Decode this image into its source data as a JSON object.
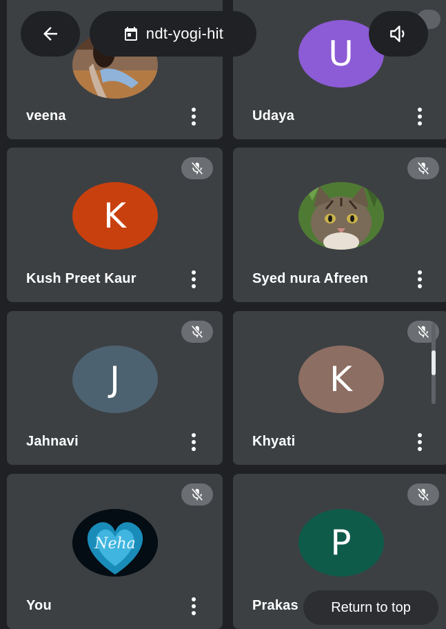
{
  "header": {
    "meeting_code": "ndt-yogi-hit",
    "back_icon": "arrow-left-icon",
    "calendar_icon": "calendar-icon",
    "speaker_icon": "speaker-icon"
  },
  "participants": [
    {
      "name": "veena",
      "avatar": "photo"
    },
    {
      "name": "Udaya",
      "initial": "U",
      "color": "#8c5bd6"
    },
    {
      "name": "Kush Preet Kaur",
      "initial": "K",
      "color": "#c9400f"
    },
    {
      "name": "Syed nura Afreen",
      "avatar": "photo"
    },
    {
      "name": "Jahnavi",
      "initial": "J",
      "color": "#4d6270"
    },
    {
      "name": "Khyati",
      "initial": "K",
      "color": "#8d6e63"
    },
    {
      "name": "You",
      "avatar": "photo",
      "avatar_text": "Neha"
    },
    {
      "name": "Prakas",
      "initial": "P",
      "color": "#0f5b4a"
    }
  ],
  "return_to_top": "Return to top",
  "colors": {
    "background": "#202124",
    "tile": "#3c4043",
    "mute_badge": "#6b6e72"
  }
}
